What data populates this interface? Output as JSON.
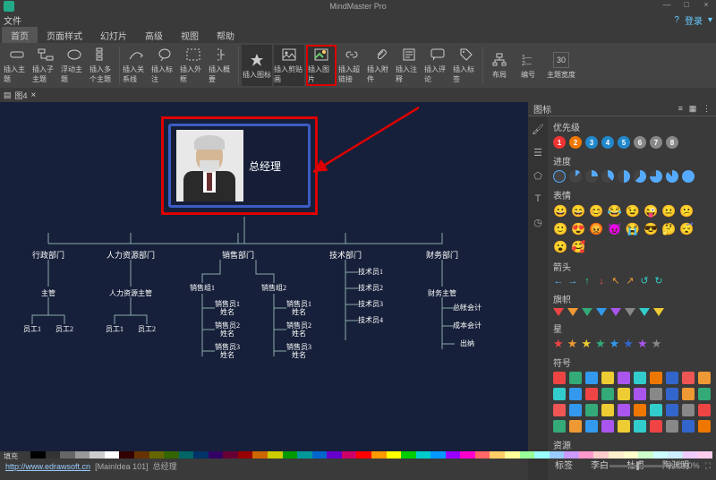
{
  "app": {
    "title": "MindMaster Pro",
    "login": "登录",
    "help": "?"
  },
  "menu": {
    "file": "文件",
    "home": "首页",
    "style": "页面样式",
    "slide": "幻灯片",
    "adv": "高级",
    "view": "视图",
    "helpm": "帮助"
  },
  "ribbon": {
    "insertTopic": "插入主题",
    "insertSub": "插入子主题",
    "floatTopic": "浮动主题",
    "multiTopic": "插入多个主题",
    "insertRel": "插入关系线",
    "insertMark": "插入标注",
    "insertBorder": "插入外框",
    "insertSummary": "插入概要",
    "insertIcon": "插入图标",
    "insertClip": "插入剪贴画",
    "insertImage": "插入图片",
    "insertLink": "插入超链接",
    "insertAttach": "插入附件",
    "insertNote": "插入注释",
    "insertComment": "插入评论",
    "insertTag": "插入标签",
    "layout": "布局",
    "number": "编号",
    "width": "主题宽度",
    "widthVal": "30"
  },
  "doc": {
    "name": "图4"
  },
  "root": {
    "label": "总经理"
  },
  "org": {
    "depts": [
      "行政部门",
      "人力资源部门",
      "销售部门",
      "技术部门",
      "财务部门"
    ],
    "d0": {
      "sup": "主管",
      "s": [
        "员工1",
        "员工2"
      ]
    },
    "d1": {
      "sup": "人力资源主管",
      "s": [
        "员工1",
        "员工2"
      ]
    },
    "d2": {
      "g1": "销售组1",
      "g2": "销售组2",
      "m": [
        "销售员1\n姓名",
        "销售员2\n姓名",
        "销售员3\n姓名",
        "销售员1\n姓名",
        "销售员2\n姓名",
        "销售员3\n姓名"
      ]
    },
    "d3": {
      "s": [
        "技术员1",
        "技术员2",
        "技术员3",
        "技术员4"
      ]
    },
    "d4": {
      "sup": "财务主管",
      "s": [
        "总帐会计",
        "成本会计",
        "出纳"
      ]
    }
  },
  "panel": {
    "title": "图标",
    "secs": {
      "priority": "优先级",
      "progress": "进度",
      "emoji": "表情",
      "arrow": "箭头",
      "flag": "旗帜",
      "star": "星",
      "symbol": "符号",
      "resource": "资源"
    },
    "res": [
      "标签",
      "李白",
      "杜甫",
      "陶渊明"
    ]
  },
  "status": {
    "fill": "填充",
    "url": "http://www.edrawsoft.cn",
    "idea": "[MainIdea 101]",
    "sel": "总经理",
    "zoom": "100%"
  }
}
